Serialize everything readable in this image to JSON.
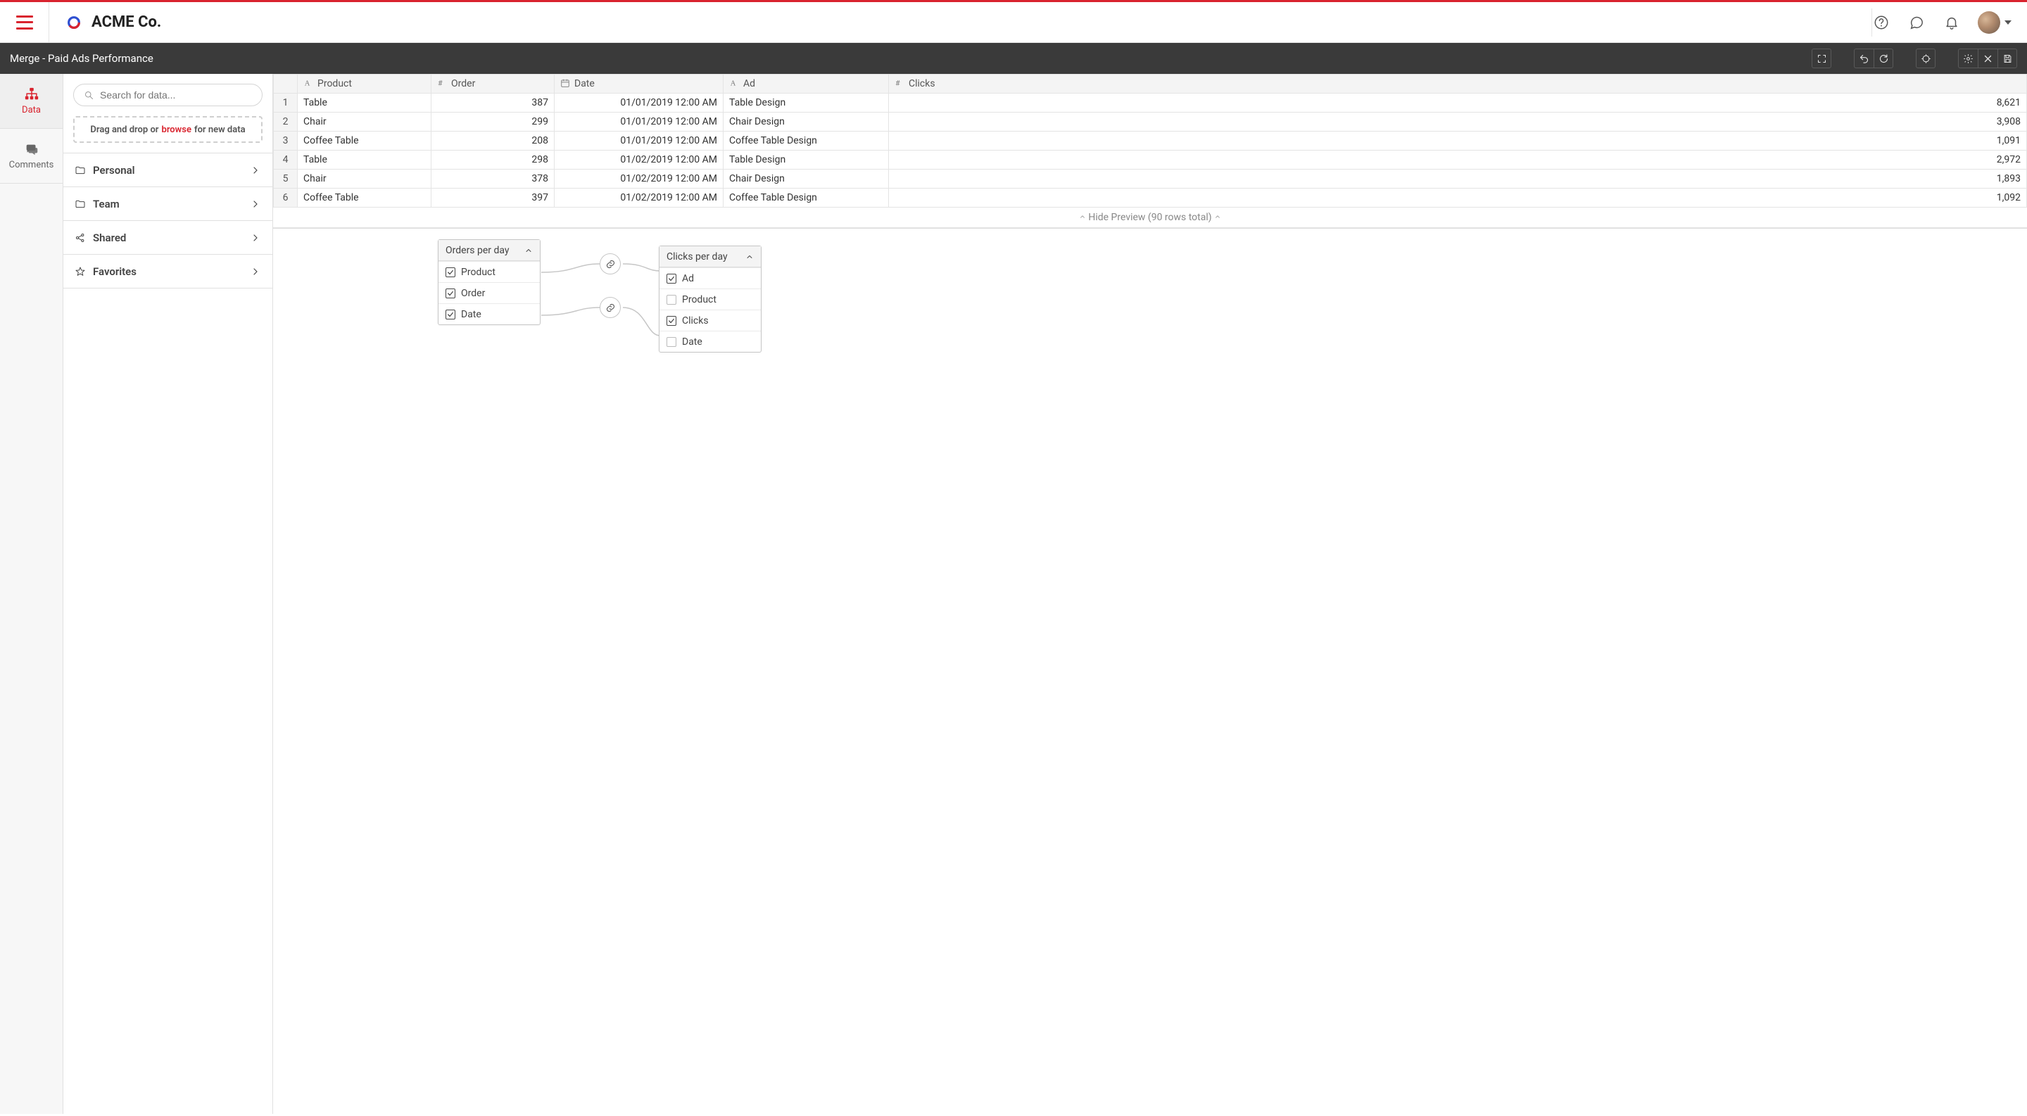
{
  "brand": {
    "name": "ACME Co."
  },
  "titlebar": {
    "title": "Merge - Paid Ads Performance"
  },
  "rail": {
    "data_label": "Data",
    "comments_label": "Comments"
  },
  "sidebar": {
    "search_placeholder": "Search for data...",
    "dropzone_pre": "Drag and drop or",
    "dropzone_browse": "browse",
    "dropzone_post": "for new data",
    "folders": {
      "personal": "Personal",
      "team": "Team",
      "shared": "Shared",
      "favorites": "Favorites"
    }
  },
  "preview": {
    "columns": {
      "product": "Product",
      "order": "Order",
      "date": "Date",
      "ad": "Ad",
      "clicks": "Clicks"
    },
    "rows": [
      {
        "n": "1",
        "product": "Table",
        "order": "387",
        "date": "01/01/2019 12:00 AM",
        "ad": "Table Design",
        "clicks": "8,621"
      },
      {
        "n": "2",
        "product": "Chair",
        "order": "299",
        "date": "01/01/2019 12:00 AM",
        "ad": "Chair Design",
        "clicks": "3,908"
      },
      {
        "n": "3",
        "product": "Coffee Table",
        "order": "208",
        "date": "01/01/2019 12:00 AM",
        "ad": "Coffee Table Design",
        "clicks": "1,091"
      },
      {
        "n": "4",
        "product": "Table",
        "order": "298",
        "date": "01/02/2019 12:00 AM",
        "ad": "Table Design",
        "clicks": "2,972"
      },
      {
        "n": "5",
        "product": "Chair",
        "order": "378",
        "date": "01/02/2019 12:00 AM",
        "ad": "Chair Design",
        "clicks": "1,893"
      },
      {
        "n": "6",
        "product": "Coffee Table",
        "order": "397",
        "date": "01/02/2019 12:00 AM",
        "ad": "Coffee Table Design",
        "clicks": "1,092"
      }
    ],
    "hide_label": "Hide Preview (90 rows total)"
  },
  "nodes": {
    "left": {
      "title": "Orders per day",
      "fields": {
        "product": "Product",
        "order": "Order",
        "date": "Date"
      }
    },
    "right": {
      "title": "Clicks per day",
      "fields": {
        "ad": "Ad",
        "product": "Product",
        "clicks": "Clicks",
        "date": "Date"
      }
    }
  }
}
